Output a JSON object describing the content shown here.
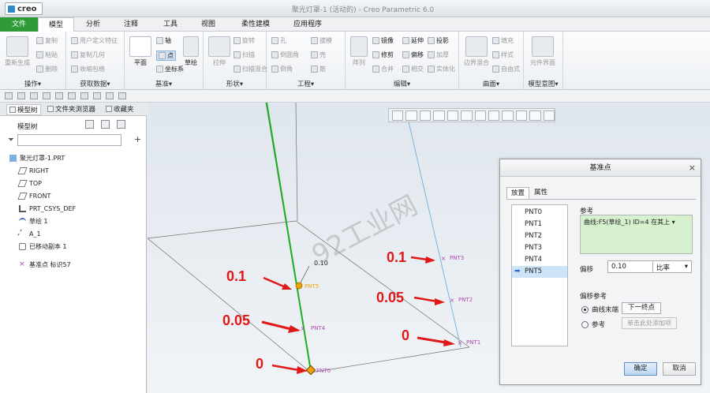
{
  "app": {
    "logo": "creo",
    "window_title": "聚光灯罩-1 (活动的) - Creo Parametric 6.0"
  },
  "tabs": [
    "文件",
    "模型",
    "分析",
    "注释",
    "工具",
    "视图",
    "柔性建模",
    "应用程序"
  ],
  "ribbon": {
    "groups": [
      {
        "label": "操作▾",
        "items": [
          "重新生成",
          "复制",
          "粘贴",
          "删除"
        ]
      },
      {
        "label": "获取数据▾",
        "items": [
          "用户定义特征",
          "复制几何",
          "收缩包络"
        ]
      },
      {
        "label": "基准▾",
        "items": [
          "平面",
          "轴",
          "点",
          "坐标系",
          "草绘"
        ]
      },
      {
        "label": "形状▾",
        "items": [
          "拉伸",
          "旋转",
          "扫描",
          "扫描混合"
        ]
      },
      {
        "label": "工程▾",
        "items": [
          "孔",
          "倒圆角",
          "倒角",
          "拔模",
          "壳",
          "筋"
        ]
      },
      {
        "label": "编辑▾",
        "items": [
          "阵列",
          "镜像",
          "修剪",
          "合并",
          "延伸",
          "偏移",
          "相交",
          "投影",
          "加厚",
          "实体化"
        ]
      },
      {
        "label": "曲面▾",
        "items": [
          "边界混合",
          "填充",
          "样式",
          "自由式"
        ]
      },
      {
        "label": "模型意图▾",
        "items": [
          "元件界面"
        ]
      }
    ]
  },
  "left_panel": {
    "tabs": [
      "模型树",
      "文件夹浏览器",
      "收藏夹"
    ],
    "title": "模型树",
    "search_placeholder": "",
    "tree": [
      {
        "label": "聚光灯罩-1.PRT",
        "icon": "part-icon"
      },
      {
        "label": "RIGHT",
        "icon": "datum-plane-icon"
      },
      {
        "label": "TOP",
        "icon": "datum-plane-icon"
      },
      {
        "label": "FRONT",
        "icon": "datum-plane-icon"
      },
      {
        "label": "PRT_CSYS_DEF",
        "icon": "csys-icon"
      },
      {
        "label": "草绘 1",
        "icon": "sketch-icon"
      },
      {
        "label": "A_1",
        "icon": "axis-icon"
      },
      {
        "label": "已移动副本 1",
        "icon": "copy-icon"
      },
      {
        "label": "基准点 标识57",
        "icon": "datum-point-icon"
      }
    ]
  },
  "viewport": {
    "watermark": "92工业网",
    "dim_label": "0.10",
    "points": [
      "PNT0",
      "PNT1",
      "PNT2",
      "PNT3",
      "PNT4",
      "PNT5"
    ],
    "annotations_left": [
      "0.1",
      "0.05",
      "0"
    ],
    "annotations_right": [
      "0.1",
      "0.05",
      "0"
    ],
    "colors": {
      "green_curve": "#1fb01f",
      "blue_curve": "#7ab6dc",
      "annotation": "#e01818",
      "point_label": "#b04ab0",
      "highlight": "#f0a000"
    }
  },
  "dialog": {
    "title": "基准点",
    "tabs": [
      "放置",
      "属性"
    ],
    "points": [
      "PNT0",
      "PNT1",
      "PNT2",
      "PNT3",
      "PNT4",
      "PNT5"
    ],
    "selected_point": "PNT5",
    "reference_label": "参考",
    "reference_value": "曲线:F5(草绘_1) ID=4",
    "reference_mode": "在其上",
    "offset_label": "偏移",
    "offset_value": "0.10",
    "offset_type": "比率",
    "offset_ref_label": "偏移参考",
    "radio_curve_end": "曲线末端",
    "radio_reference": "参考",
    "next_endpoint": "下一终点",
    "add_ref_placeholder": "单击此处添加项",
    "ok": "确定",
    "cancel": "取消"
  }
}
